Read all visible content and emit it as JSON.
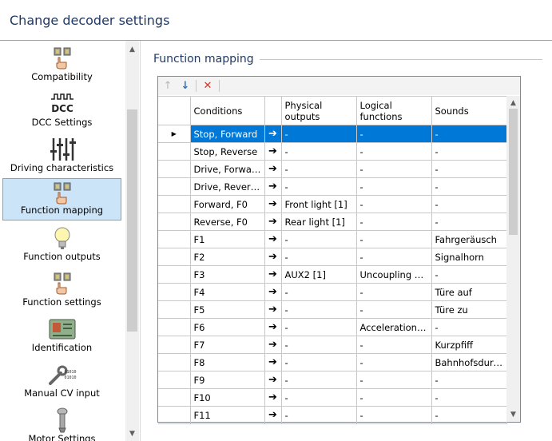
{
  "window": {
    "title": "Change decoder settings"
  },
  "nav": {
    "items": [
      {
        "label": "Compatibility",
        "icon": "compatibility-icon"
      },
      {
        "label": "DCC Settings",
        "icon": "dcc-settings-icon",
        "icon_text": "DCC"
      },
      {
        "label": "Driving characteristics",
        "icon": "sliders-icon"
      },
      {
        "label": "Function mapping",
        "icon": "function-mapping-icon",
        "selected": true
      },
      {
        "label": "Function outputs",
        "icon": "light-bulb-icon"
      },
      {
        "label": "Function settings",
        "icon": "function-settings-icon"
      },
      {
        "label": "Identification",
        "icon": "id-card-icon"
      },
      {
        "label": "Manual CV input",
        "icon": "wrench-icon",
        "icon_text": "01010"
      },
      {
        "label": "Motor Settings",
        "icon": "motor-icon"
      }
    ]
  },
  "section": {
    "title": "Function mapping"
  },
  "toolbar": {
    "up_icon": "↑",
    "down_icon": "↓",
    "delete_icon": "✕"
  },
  "grid": {
    "columns": [
      "Conditions",
      "Physical outputs",
      "Logical functions",
      "Sounds"
    ],
    "rows": [
      {
        "condition": "Stop, Forward",
        "physical": "-",
        "logical": "-",
        "sound": "-",
        "selected": true
      },
      {
        "condition": "Stop, Reverse",
        "physical": "-",
        "logical": "-",
        "sound": "-"
      },
      {
        "condition": "Drive, Forward...",
        "physical": "-",
        "logical": "-",
        "sound": "-"
      },
      {
        "condition": "Drive, Reverse",
        "physical": "-",
        "logical": "-",
        "sound": "-"
      },
      {
        "condition": "Forward, F0",
        "physical": "Front light [1]",
        "logical": "-",
        "sound": "-"
      },
      {
        "condition": "Reverse, F0",
        "physical": "Rear light [1]",
        "logical": "-",
        "sound": "-"
      },
      {
        "condition": "F1",
        "physical": "-",
        "logical": "-",
        "sound": "Fahrgeräusch"
      },
      {
        "condition": "F2",
        "physical": "-",
        "logical": "-",
        "sound": "Signalhorn"
      },
      {
        "condition": "F3",
        "physical": "AUX2 [1]",
        "logical": "Uncoupling c...",
        "sound": "-"
      },
      {
        "condition": "F4",
        "physical": "-",
        "logical": "-",
        "sound": "Türe auf"
      },
      {
        "condition": "F5",
        "physical": "-",
        "logical": "-",
        "sound": "Türe zu"
      },
      {
        "condition": "F6",
        "physical": "-",
        "logical": "Acceleration, ...",
        "sound": "-"
      },
      {
        "condition": "F7",
        "physical": "-",
        "logical": "-",
        "sound": "Kurzpfiff"
      },
      {
        "condition": "F8",
        "physical": "-",
        "logical": "-",
        "sound": "Bahnhofsdurc..."
      },
      {
        "condition": "F9",
        "physical": "-",
        "logical": "-",
        "sound": "-"
      },
      {
        "condition": "F10",
        "physical": "-",
        "logical": "-",
        "sound": "-"
      },
      {
        "condition": "F11",
        "physical": "-",
        "logical": "-",
        "sound": "-"
      }
    ]
  },
  "colors": {
    "accent": "#0078d7",
    "title": "#1f3864",
    "nav_selected": "#cce4f7"
  }
}
